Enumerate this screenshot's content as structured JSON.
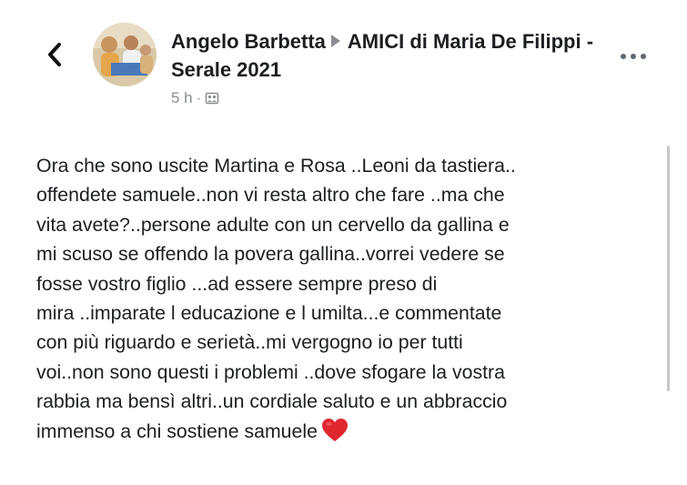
{
  "header": {
    "back_icon": "chevron-left-icon",
    "author": "Angelo Barbetta",
    "group": "AMICI di Maria De Filippi - Serale 2021",
    "time": "5 h",
    "separator": "·",
    "audience_icon": "group-audience-icon",
    "more_icon": "more-dots-icon"
  },
  "post": {
    "text": "Ora che sono uscite Martina e Rosa ..Leoni da tastiera..\noffendete samuele..non vi resta altro che fare ..ma che\nvita avete?..persone adulte con un cervello da gallina e\nmi scuso se offendo la povera gallina..vorrei vedere se\nfosse vostro figlio ...ad essere sempre preso di\nmira ..imparate l educazione e l umilta...e commentate\ncon più riguardo e serietà..mi vergogno io per tutti\nvoi..non sono questi i problemi ..dove sfogare la vostra\nrabbia ma bensì altri..un cordiale saluto e un abbraccio\nimmenso a chi sostiene samuele",
    "emoji_icon": "red-heart-icon"
  },
  "colors": {
    "text": "#1c1e21",
    "secondary": "#8a8d91",
    "heart": "#e0262f"
  }
}
